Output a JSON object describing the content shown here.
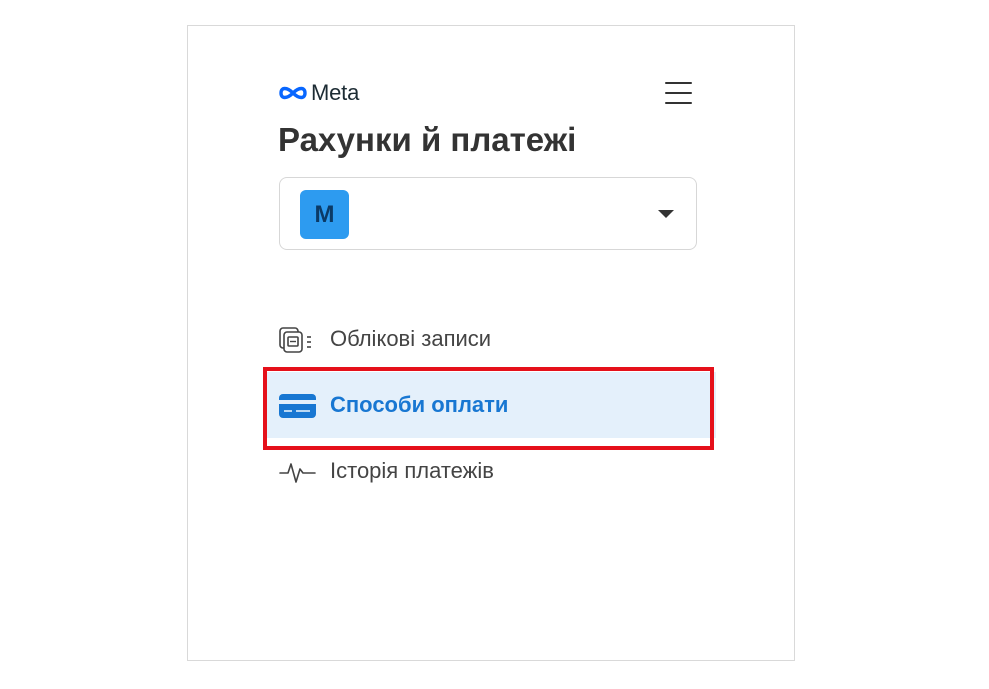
{
  "header": {
    "logo_text": "Meta",
    "menu_icon": "hamburger-menu-icon"
  },
  "page": {
    "title": "Рахунки й платежі"
  },
  "account": {
    "avatar_letter": "M",
    "dropdown_icon": "caret-down-icon"
  },
  "nav": {
    "items": [
      {
        "label": "Облікові записи",
        "icon": "accounts-icon",
        "active": false
      },
      {
        "label": "Способи оплати",
        "icon": "credit-card-icon",
        "active": true
      },
      {
        "label": "Історія платежів",
        "icon": "activity-pulse-icon",
        "active": false
      }
    ]
  },
  "colors": {
    "accent": "#1877d2",
    "active_bg": "#e4f0fb",
    "avatar_bg": "#2d9bf0",
    "highlight": "#e5101a",
    "text": "#333333"
  }
}
